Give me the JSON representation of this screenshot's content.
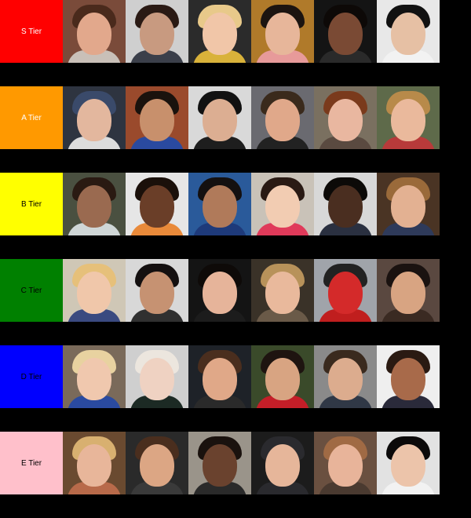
{
  "tiers": [
    {
      "label": "S Tier",
      "color": "#ff0000",
      "text_color": "#ffffff",
      "items": [
        {
          "bg": "#7a4b3a",
          "skin": "#e2a88c",
          "hair": "#4a2a1c",
          "shirt": "#c9c0b8"
        },
        {
          "bg": "#cfcfcf",
          "skin": "#c89a80",
          "hair": "#2a1a14",
          "shirt": "#3b3f4a"
        },
        {
          "bg": "#2b2b2b",
          "skin": "#f1c6a8",
          "hair": "#e8c98a",
          "shirt": "#d9b23a"
        },
        {
          "bg": "#b07a2a",
          "skin": "#e7b69a",
          "hair": "#1c1410",
          "shirt": "#e79a9a"
        },
        {
          "bg": "#141414",
          "skin": "#7a4a34",
          "hair": "#0d0907",
          "shirt": "#2a2a2a"
        },
        {
          "bg": "#e8e8e8",
          "skin": "#e6c0a4",
          "hair": "#111111",
          "shirt": "#f2f2f2"
        }
      ]
    },
    {
      "label": "A Tier",
      "color": "#ff9900",
      "text_color": "#ffffff",
      "items": [
        {
          "bg": "#2e3440",
          "skin": "#e3b79e",
          "hair": "#3a4a6a",
          "shirt": "#dcdcdc"
        },
        {
          "bg": "#9a4a2c",
          "skin": "#c8906c",
          "hair": "#1a120d",
          "shirt": "#2a4aa0"
        },
        {
          "bg": "#d9d9d9",
          "skin": "#dcae92",
          "hair": "#111111",
          "shirt": "#1e1e1e"
        },
        {
          "bg": "#6a6a70",
          "skin": "#e0a88a",
          "hair": "#3a2a1c",
          "shirt": "#222222"
        },
        {
          "bg": "#7a7060",
          "skin": "#e9b7a0",
          "hair": "#7a3a1c",
          "shirt": "#5a4a40"
        },
        {
          "bg": "#5e6a4a",
          "skin": "#eab99c",
          "hair": "#b88a4a",
          "shirt": "#b83a3a"
        }
      ]
    },
    {
      "label": "B Tier",
      "color": "#ffff00",
      "text_color": "#000000",
      "items": [
        {
          "bg": "#4a5040",
          "skin": "#9a6a50",
          "hair": "#2a1a12",
          "shirt": "#cfd6d6"
        },
        {
          "bg": "#e6e6e6",
          "skin": "#6a3e28",
          "hair": "#1a100a",
          "shirt": "#e98a3a"
        },
        {
          "bg": "#2a5a9a",
          "skin": "#b07a5a",
          "hair": "#141010",
          "shirt": "#1e3a7a"
        },
        {
          "bg": "#c9c2b8",
          "skin": "#f2ccb2",
          "hair": "#2a1a14",
          "shirt": "#e03a5a"
        },
        {
          "bg": "#d8d8d8",
          "skin": "#4a2e20",
          "hair": "#0c0a08",
          "shirt": "#2a3040"
        },
        {
          "bg": "#4a3424",
          "skin": "#e3b192",
          "hair": "#9a6a3a",
          "shirt": "#2e3a5a"
        }
      ]
    },
    {
      "label": "C Tier",
      "color": "#008000",
      "text_color": "#000000",
      "items": [
        {
          "bg": "#cfc7b6",
          "skin": "#f0c7aa",
          "hair": "#e6c07a",
          "shirt": "#3a4a80"
        },
        {
          "bg": "#d8d8d8",
          "skin": "#c69272",
          "hair": "#141010",
          "shirt": "#303030"
        },
        {
          "bg": "#141414",
          "skin": "#e6b49a",
          "hair": "#0e0a08",
          "shirt": "#1c1c1c"
        },
        {
          "bg": "#3a3228",
          "skin": "#e9b99c",
          "hair": "#b8925a",
          "shirt": "#6a5a48"
        },
        {
          "bg": "#a0a4aa",
          "skin": "#d42a2a",
          "hair": "#222222",
          "shirt": "#c01e1e"
        },
        {
          "bg": "#5a4840",
          "skin": "#d8a482",
          "hair": "#1a1210",
          "shirt": "#3a2a22"
        }
      ]
    },
    {
      "label": "D Tier",
      "color": "#0000ff",
      "text_color": "#000000",
      "items": [
        {
          "bg": "#7a6a5a",
          "skin": "#f0c8ae",
          "hair": "#e8d2a0",
          "shirt": "#2a4aa0"
        },
        {
          "bg": "#cfcfcf",
          "skin": "#efd2c2",
          "hair": "#ece6de",
          "shirt": "#1c2a24"
        },
        {
          "bg": "#1e2228",
          "skin": "#e0a888",
          "hair": "#4a2e1e",
          "shirt": "#2a2a2a"
        },
        {
          "bg": "#3a4a2a",
          "skin": "#d8a482",
          "hair": "#1e1410",
          "shirt": "#c41e28"
        },
        {
          "bg": "#8a8a8a",
          "skin": "#dcac8e",
          "hair": "#3a2a1e",
          "shirt": "#303846"
        },
        {
          "bg": "#efefef",
          "skin": "#a86a4a",
          "hair": "#2a1a12",
          "shirt": "#2a2a3a"
        }
      ]
    },
    {
      "label": "E Tier",
      "color": "#ffc0cb",
      "text_color": "#000000",
      "items": [
        {
          "bg": "#6a4a30",
          "skin": "#e8b69a",
          "hair": "#d8b070",
          "shirt": "#b86a4a"
        },
        {
          "bg": "#2a2a2a",
          "skin": "#dca684",
          "hair": "#4a2e1e",
          "shirt": "#3a3a3a"
        },
        {
          "bg": "#9a948a",
          "skin": "#6a422e",
          "hair": "#1a120e",
          "shirt": "#2a2a2a"
        },
        {
          "bg": "#1c1c1c",
          "skin": "#e6b69a",
          "hair": "#2a2a2e",
          "shirt": "#2a2a2e"
        },
        {
          "bg": "#6a5040",
          "skin": "#e8b49a",
          "hair": "#a06a44",
          "shirt": "#4a3a30"
        },
        {
          "bg": "#e2e2e2",
          "skin": "#ecc4aa",
          "hair": "#0c0a0a",
          "shirt": "#f2f2f2"
        }
      ]
    }
  ]
}
